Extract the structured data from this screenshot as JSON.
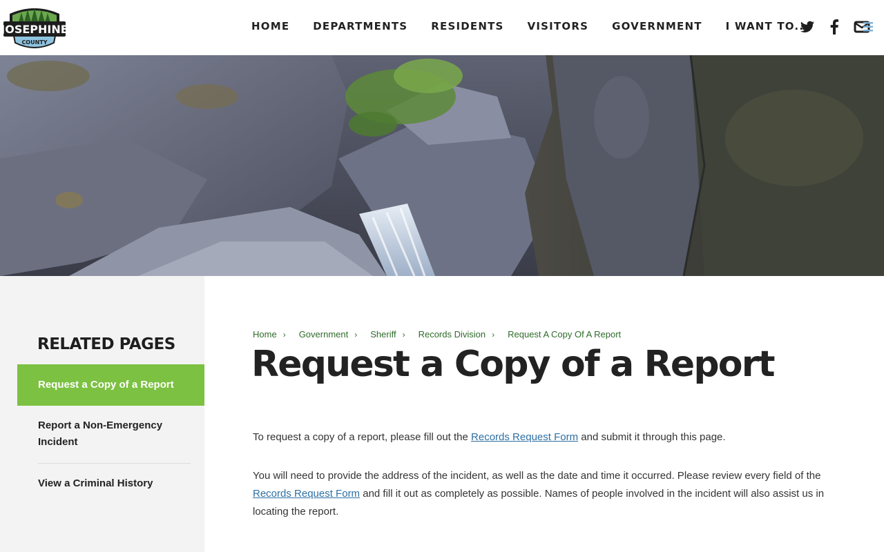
{
  "site": {
    "logo_text": "JOSEPHINE",
    "logo_subtext": "COUNTY",
    "logo_icon": "trees-mountain-badge-icon"
  },
  "nav": {
    "items": [
      {
        "label": "HOME"
      },
      {
        "label": "DEPARTMENTS"
      },
      {
        "label": "RESIDENTS"
      },
      {
        "label": "VISITORS"
      },
      {
        "label": "GOVERNMENT"
      },
      {
        "label": "I WANT TO..."
      }
    ]
  },
  "social": {
    "icons": [
      "twitter-icon",
      "facebook-icon",
      "email-menu-icon"
    ]
  },
  "hero": {
    "icon": "rock-waterfall-photo"
  },
  "sidebar": {
    "title": "RELATED PAGES",
    "items": [
      {
        "label": "Request a Copy of a Report",
        "active": true
      },
      {
        "label": "Report a Non-Emergency Incident",
        "active": false
      },
      {
        "label": "View a Criminal History",
        "active": false
      }
    ]
  },
  "breadcrumb": {
    "items": [
      "Home",
      "Government",
      "Sheriff",
      "Records Division",
      "Request A Copy Of A Report"
    ],
    "separator": "›"
  },
  "main": {
    "title": "Request a Copy of a Report",
    "para1_before": "To request a copy of a report, please fill out the ",
    "para1_link": "Records Request Form",
    "para1_after": " and submit it through this page.",
    "para2_before": "You will need to provide the address of the incident, as well as the date and time it occurred. Please review every field of the ",
    "para2_link": "Records Request Form",
    "para2_after": " and fill it out as completely as possible. Names of people involved in the incident will also assist us in locating the report."
  },
  "colors": {
    "accent_green": "#7cc142",
    "breadcrumb_green": "#2f6b2a",
    "link_blue": "#2d6fa3",
    "sidebar_bg": "#f3f3f3"
  }
}
